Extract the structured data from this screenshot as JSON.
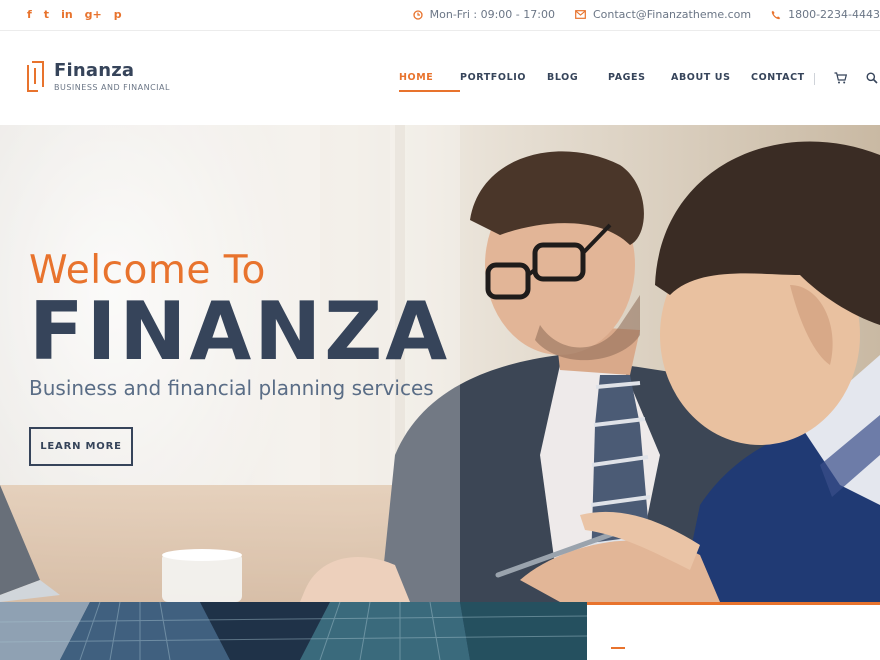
{
  "topbar": {
    "social": [
      {
        "icon": "facebook-icon",
        "glyph": "f"
      },
      {
        "icon": "twitter-icon",
        "glyph": "t"
      },
      {
        "icon": "linkedin-icon",
        "glyph": "in"
      },
      {
        "icon": "google-plus-icon",
        "glyph": "g+"
      },
      {
        "icon": "pinterest-icon",
        "glyph": "p"
      }
    ],
    "hours": "Mon-Fri : 09:00 - 17:00",
    "email": "Contact@Finanzatheme.com",
    "phone": "1800-2234-4443"
  },
  "brand": {
    "name": "Finanza",
    "tagline": "BUSINESS AND FINANCIAL"
  },
  "nav": {
    "items": [
      {
        "label": "HOME",
        "active": true
      },
      {
        "label": "PORTFOLIO",
        "active": false
      },
      {
        "label": "BLOG",
        "active": false
      },
      {
        "label": "PAGES",
        "active": false
      },
      {
        "label": "ABOUT US",
        "active": false
      },
      {
        "label": "CONTACT",
        "active": false
      }
    ]
  },
  "hero": {
    "welcome": "Welcome To",
    "title": "FINANZA",
    "subtitle": "Business and financial planning services",
    "button": "LEARN MORE"
  },
  "colors": {
    "accent": "#e8732d",
    "navy": "#36445a"
  }
}
